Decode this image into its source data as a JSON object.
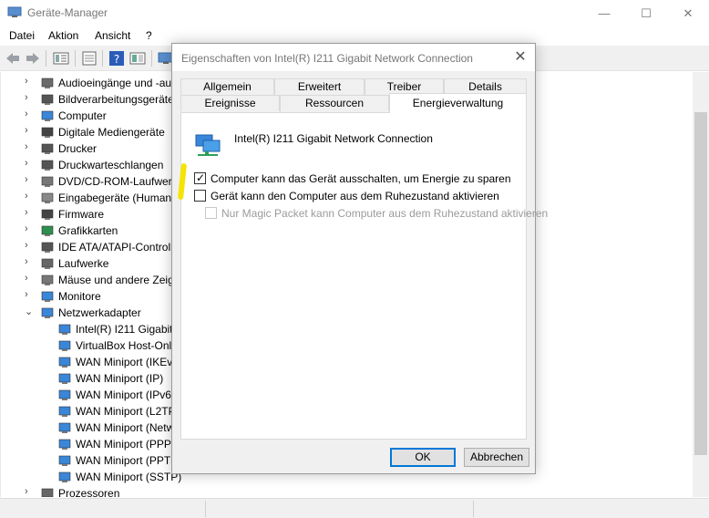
{
  "window": {
    "title": "Geräte-Manager",
    "minimize": "—",
    "maximize": "☐",
    "close": "✕"
  },
  "menu": [
    "Datei",
    "Aktion",
    "Ansicht",
    "?"
  ],
  "tree": {
    "categories": [
      {
        "label": "Audioeingänge und -au",
        "expanded": false
      },
      {
        "label": "Bildverarbeitungsgeräte",
        "expanded": false
      },
      {
        "label": "Computer",
        "expanded": false
      },
      {
        "label": "Digitale Mediengeräte",
        "expanded": false
      },
      {
        "label": "Drucker",
        "expanded": false
      },
      {
        "label": "Druckwarteschlangen",
        "expanded": false
      },
      {
        "label": "DVD/CD-ROM-Laufwerk",
        "expanded": false
      },
      {
        "label": "Eingabegeräte (Human",
        "expanded": false
      },
      {
        "label": "Firmware",
        "expanded": false
      },
      {
        "label": "Grafikkarten",
        "expanded": false
      },
      {
        "label": "IDE ATA/ATAPI-Controlle",
        "expanded": false
      },
      {
        "label": "Laufwerke",
        "expanded": false
      },
      {
        "label": "Mäuse und andere Zeig",
        "expanded": false
      },
      {
        "label": "Monitore",
        "expanded": false
      },
      {
        "label": "Netzwerkadapter",
        "expanded": true
      }
    ],
    "network_children": [
      "Intel(R) I211 Gigabit",
      "VirtualBox Host-Onl",
      "WAN Miniport (IKEv",
      "WAN Miniport (IP)",
      "WAN Miniport (IPv6",
      "WAN Miniport (L2TP",
      "WAN Miniport (Netw",
      "WAN Miniport (PPP",
      "WAN Miniport (PPT",
      "WAN Miniport (SSTP)"
    ],
    "after": [
      {
        "label": "Prozessoren",
        "expanded": false
      }
    ]
  },
  "dialog": {
    "title": "Eigenschaften von Intel(R) I211 Gigabit Network Connection",
    "close": "✕",
    "tabs_row1": [
      "Allgemein",
      "Erweitert",
      "Treiber",
      "Details"
    ],
    "tabs_row2": [
      "Ereignisse",
      "Ressourcen",
      "Energieverwaltung"
    ],
    "active_tab": "Energieverwaltung",
    "device_name": "Intel(R) I211 Gigabit Network Connection",
    "options": [
      {
        "label": "Computer kann das Gerät ausschalten, um Energie zu sparen",
        "checked": true,
        "enabled": true
      },
      {
        "label": "Gerät kann den Computer aus dem Ruhezustand aktivieren",
        "checked": false,
        "enabled": true
      },
      {
        "label": "Nur Magic Packet kann Computer aus dem Ruhezustand aktivieren",
        "checked": false,
        "enabled": false
      }
    ],
    "ok_label": "OK",
    "cancel_label": "Abbrechen"
  },
  "colors": {
    "accent": "#0078d7",
    "highlight_mark": "#f5e300"
  }
}
